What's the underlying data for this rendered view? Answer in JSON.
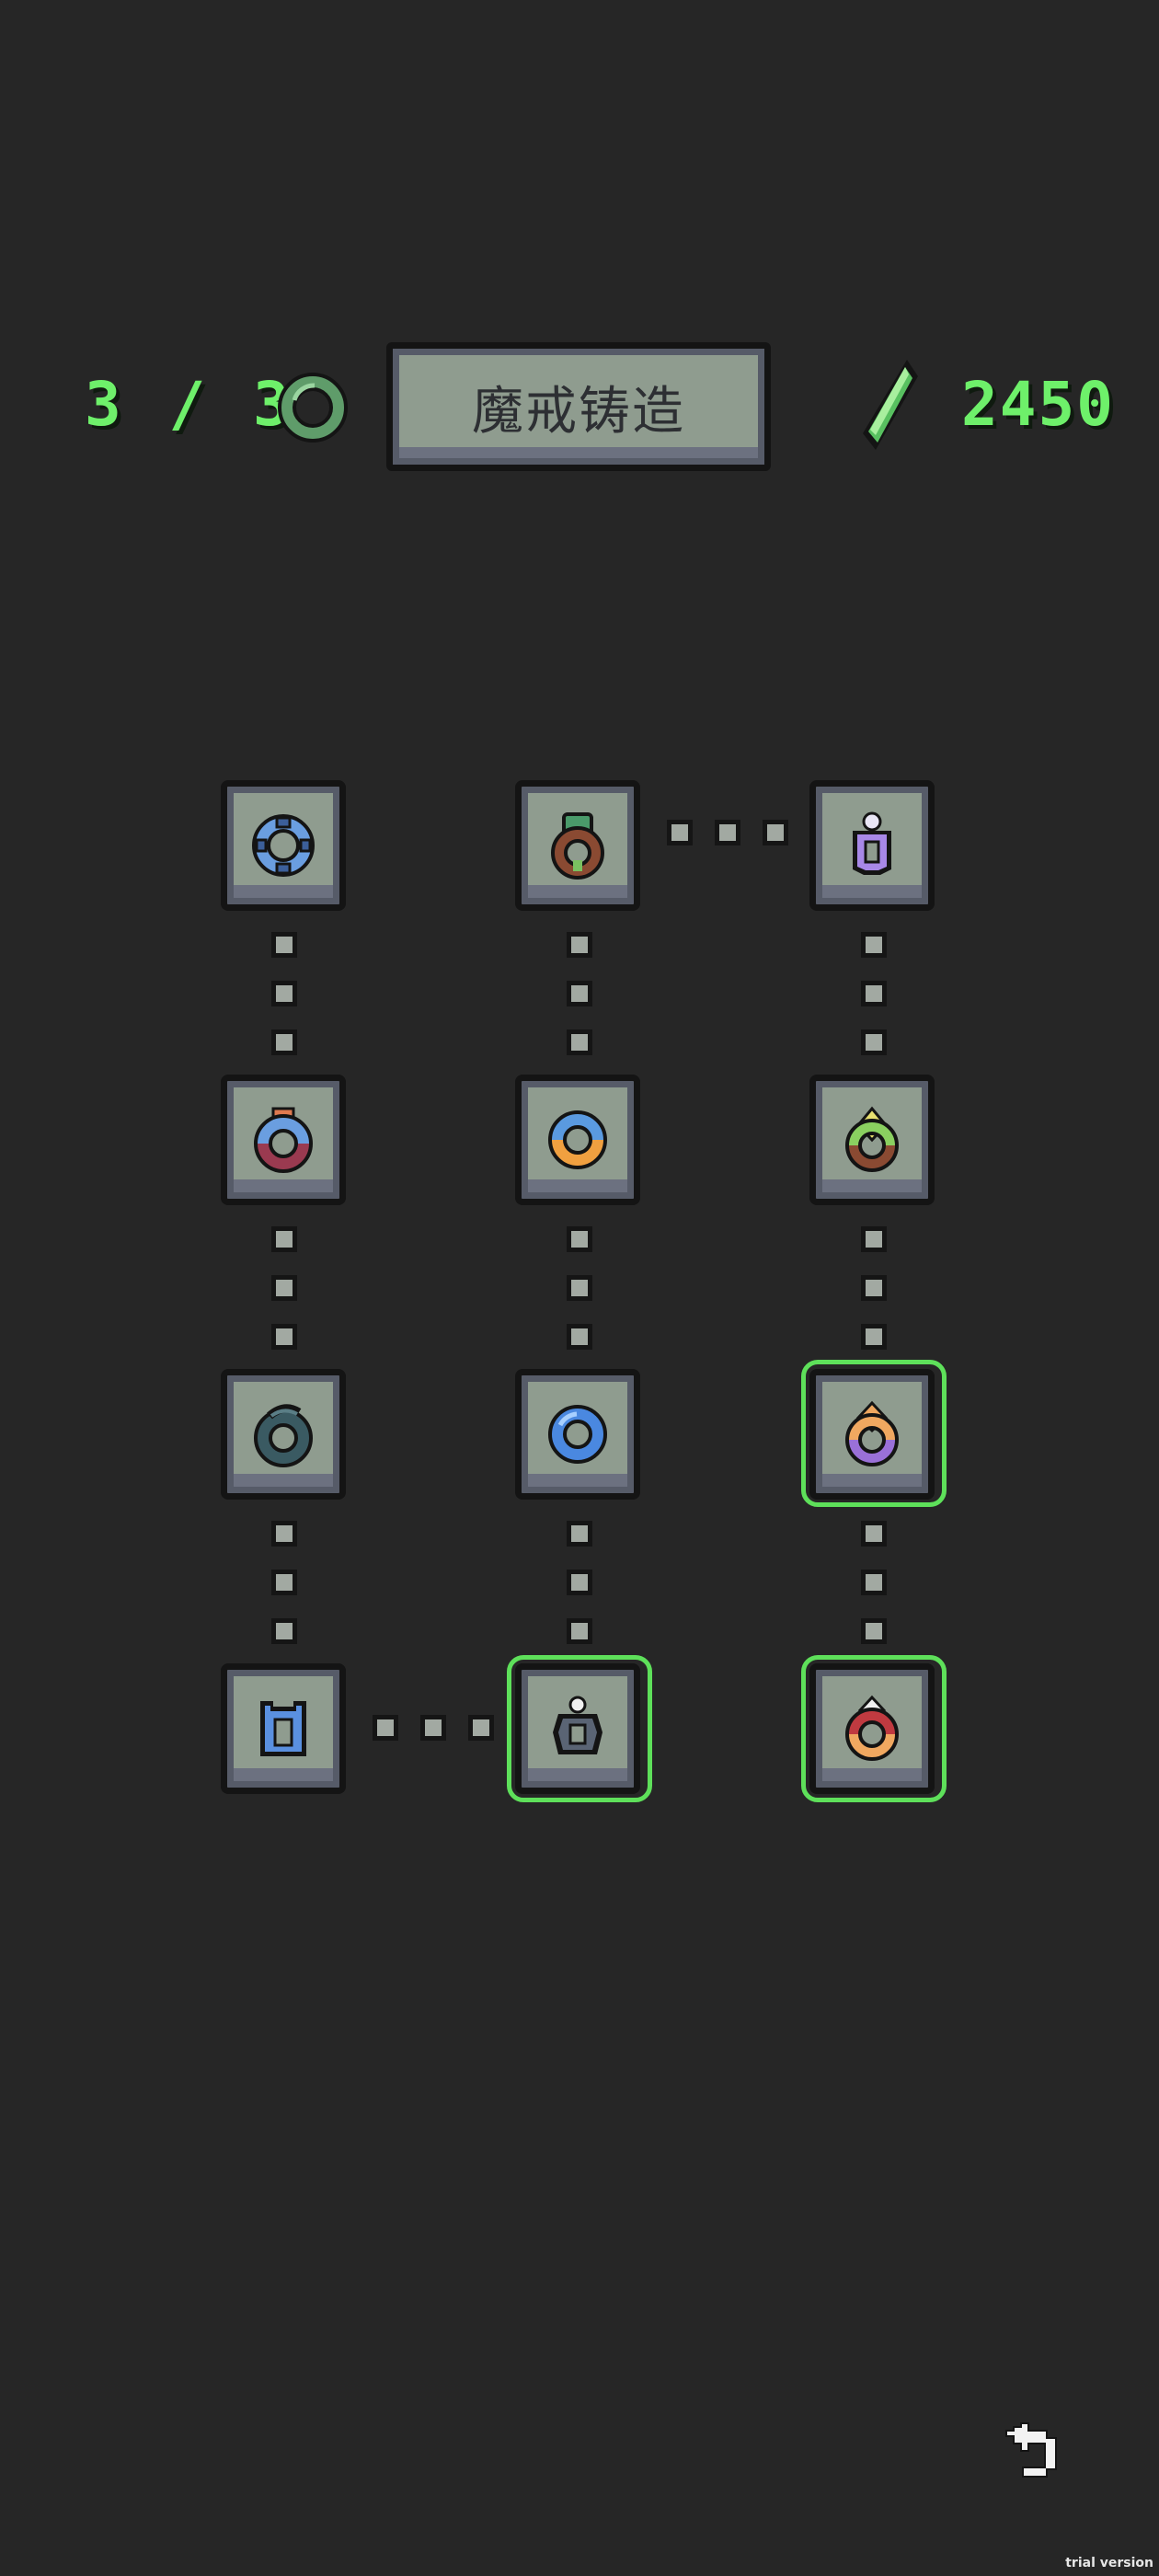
{
  "header": {
    "counter": "3 / 3",
    "title_button": "魔戒铸造",
    "gem_count": "2450",
    "counter_icon": "ring-icon",
    "currency_icon": "green-gem-icon"
  },
  "colors": {
    "background": "#262626",
    "accent_green": "#6ef06a",
    "tile_face": "#8f9c8f",
    "tile_border": "#565b68",
    "selected_outline": "#5ee05a"
  },
  "grid": {
    "columns": 3,
    "rows": 4,
    "nodes": [
      {
        "name": "blue-ring",
        "selected": false
      },
      {
        "name": "brown-green-amulet",
        "selected": false
      },
      {
        "name": "purple-pendant",
        "selected": false
      },
      {
        "name": "red-blue-ring",
        "selected": false
      },
      {
        "name": "orange-blue-ring",
        "selected": false
      },
      {
        "name": "green-gem-amulet",
        "selected": false
      },
      {
        "name": "dark-spiral-ring",
        "selected": false
      },
      {
        "name": "blue-crystal-ring",
        "selected": false
      },
      {
        "name": "orange-purple-ring",
        "selected": true
      },
      {
        "name": "blue-armor-charm",
        "selected": false
      },
      {
        "name": "gray-pearl-charm",
        "selected": true
      },
      {
        "name": "red-orange-amulet",
        "selected": true
      }
    ]
  },
  "footer": {
    "back_icon": "undo-arrow-icon",
    "watermark": "trial version"
  }
}
